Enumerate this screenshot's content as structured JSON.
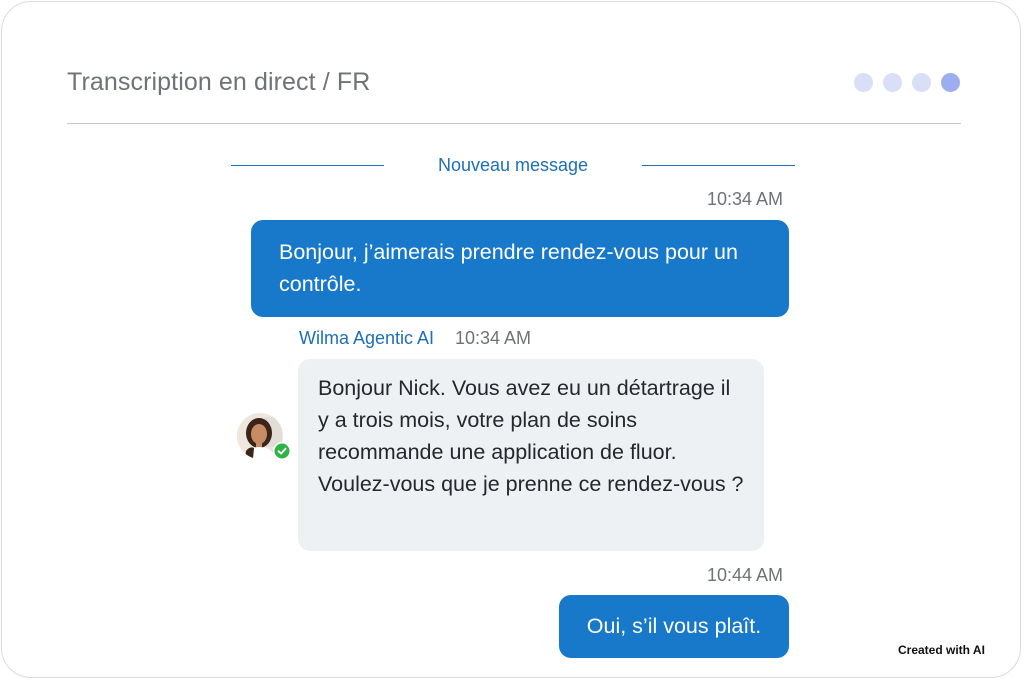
{
  "header": {
    "title": "Transcription en direct / FR"
  },
  "separator": {
    "label": "Nouveau message"
  },
  "messages": [
    {
      "time": "10:34 AM",
      "text": "Bonjour, j’aimerais prendre rendez-vous pour un contrôle."
    },
    {
      "sender": "Wilma Agentic AI",
      "time": "10:34 AM",
      "text": "Bonjour Nick. Vous avez eu un détartrage il y a trois mois, votre plan de soins recommande une application de fluor. Voulez-vous que je prenne ce rendez-vous ?"
    },
    {
      "time": "10:44 AM",
      "text": "Oui, s’il vous plaît."
    }
  ],
  "watermark": "Created with AI",
  "colors": {
    "accent": "#1878c9",
    "link": "#1d6fb8",
    "incoming_bubble": "#eef1f4",
    "online_status": "#2fb344",
    "dot_inactive": "#d8dff7",
    "dot_active": "#9daef0"
  },
  "icons": {
    "avatar": "agent-avatar",
    "status": "check-icon"
  }
}
